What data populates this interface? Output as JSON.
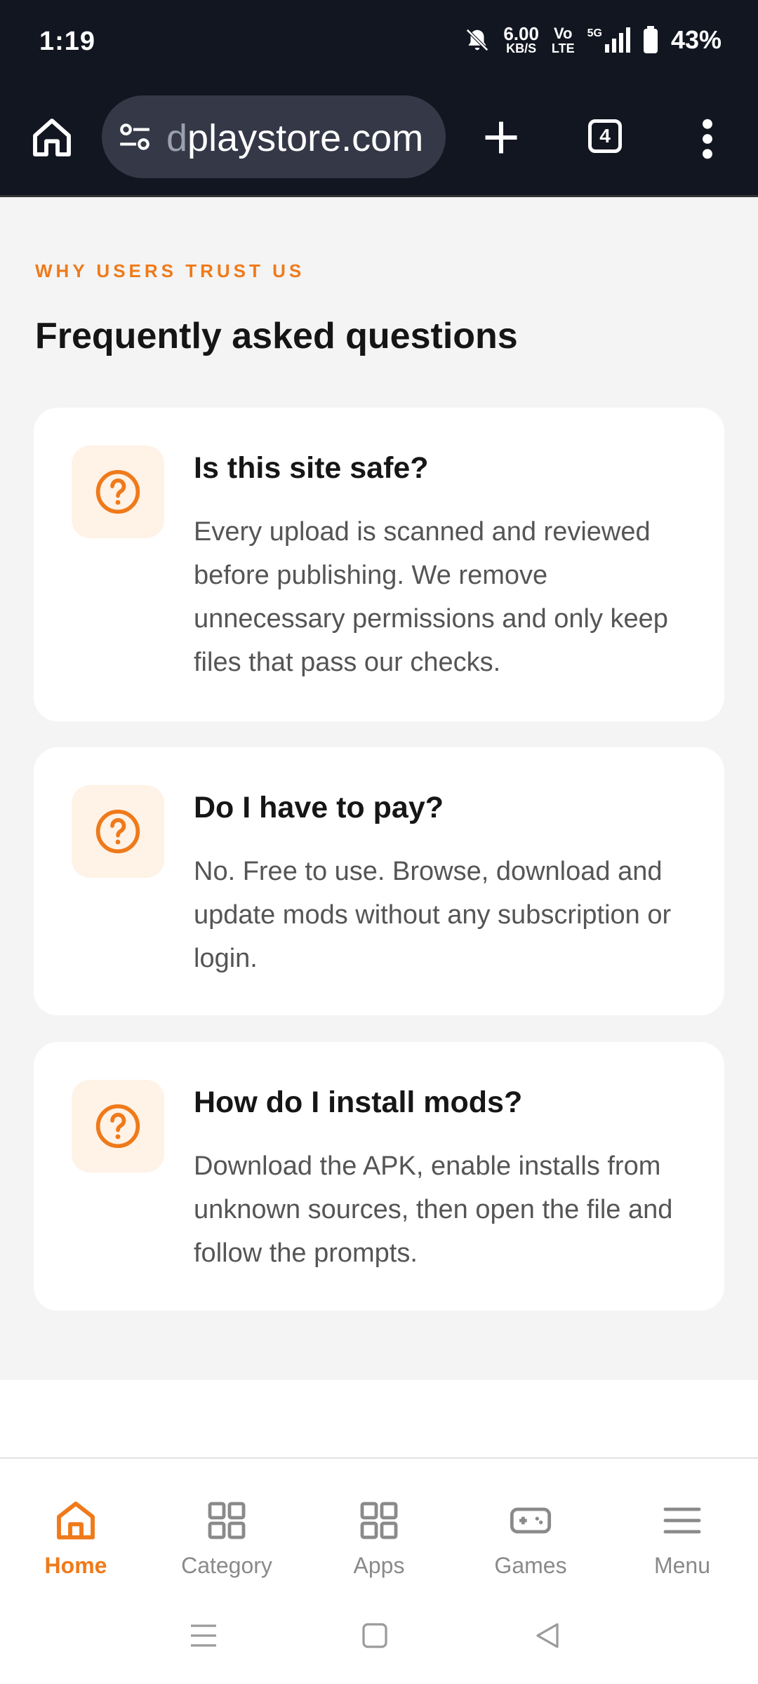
{
  "status_bar": {
    "time": "1:19",
    "net_speed_value": "6.00",
    "net_speed_unit": "KB/S",
    "volte_top": "Vo",
    "volte_bottom": "LTE",
    "network": "5G",
    "battery": "43%"
  },
  "browser": {
    "url_fade": "d",
    "url": "playstore.com",
    "tab_count": "4"
  },
  "faq": {
    "eyebrow": "WHY USERS TRUST US",
    "title": "Frequently asked questions",
    "items": [
      {
        "question": "Is this site safe?",
        "answer": "Every upload is scanned and reviewed before publishing. We remove unnecessary permissions and only keep files that pass our checks."
      },
      {
        "question": "Do I have to pay?",
        "answer": "No. Free to use. Browse, download and update mods without any subscription or login."
      },
      {
        "question": "How do I install mods?",
        "answer": "Download the APK, enable installs from unknown sources, then open the file and follow the prompts."
      }
    ]
  },
  "bottom_nav": {
    "items": [
      {
        "label": "Home",
        "icon": "home-icon",
        "active": true
      },
      {
        "label": "Category",
        "icon": "grid-icon",
        "active": false
      },
      {
        "label": "Apps",
        "icon": "grid-icon",
        "active": false
      },
      {
        "label": "Games",
        "icon": "gamepad-icon",
        "active": false
      },
      {
        "label": "Menu",
        "icon": "menu-icon",
        "active": false
      }
    ]
  },
  "colors": {
    "accent": "#ef7a1a",
    "header_bg": "#121621",
    "page_bg": "#f4f4f4"
  }
}
